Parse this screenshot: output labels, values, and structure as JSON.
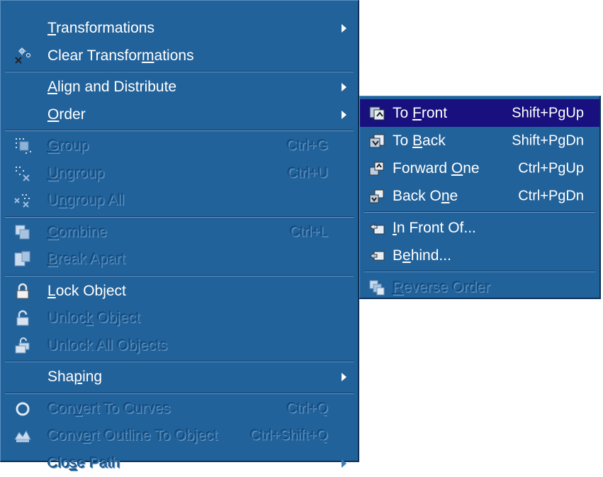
{
  "main_menu": {
    "transformations": {
      "label": "Transformations",
      "accel": "T",
      "icon": "none"
    },
    "clear_transformations": {
      "label": "Clear Transformations",
      "accel": "m",
      "icon": "clear-transform-icon"
    },
    "align_distribute": {
      "label": "Align and Distribute",
      "accel": "A"
    },
    "order": {
      "label": "Order",
      "accel": "O"
    },
    "group": {
      "label": "Group",
      "accel": "G",
      "shortcut": "Ctrl+G",
      "icon": "group-icon"
    },
    "ungroup": {
      "label": "Ungroup",
      "accel": "U",
      "shortcut": "Ctrl+U",
      "icon": "ungroup-icon"
    },
    "ungroup_all": {
      "label": "Ungroup All",
      "accel": "n",
      "icon": "ungroup-all-icon"
    },
    "combine": {
      "label": "Combine",
      "accel": "C",
      "shortcut": "Ctrl+L",
      "icon": "combine-icon"
    },
    "break_apart": {
      "label": "Break Apart",
      "accel": "B",
      "icon": "break-apart-icon"
    },
    "lock_object": {
      "label": "Lock Object",
      "accel": "L",
      "icon": "lock-icon"
    },
    "unlock_object": {
      "label": "Unlock Object",
      "accel": "k",
      "icon": "unlock-icon"
    },
    "unlock_all": {
      "label": "Unlock All Objects",
      "icon": "unlock-all-icon"
    },
    "shaping": {
      "label": "Shaping",
      "accel": "p"
    },
    "convert_curves": {
      "label": "Convert To Curves",
      "accel": "v",
      "shortcut": "Ctrl+Q",
      "icon": "convert-curves-icon"
    },
    "convert_outline": {
      "label": "Convert Outline To Object",
      "accel": "e",
      "shortcut": "Ctrl+Shift+Q",
      "icon": "convert-outline-icon"
    },
    "close_path": {
      "label": "Close Path",
      "accel": "s"
    }
  },
  "order_submenu": {
    "to_front": {
      "label": "To Front",
      "accel": "F",
      "shortcut": "Shift+PgUp",
      "icon": "to-front-icon"
    },
    "to_back": {
      "label": "To Back",
      "accel": "B",
      "shortcut": "Shift+PgDn",
      "icon": "to-back-icon"
    },
    "forward_one": {
      "label": "Forward One",
      "accel": "O",
      "shortcut": "Ctrl+PgUp",
      "icon": "forward-one-icon"
    },
    "back_one": {
      "label": "Back One",
      "accel": "n",
      "shortcut": "Ctrl+PgDn",
      "icon": "back-one-icon"
    },
    "in_front_of": {
      "label": "In Front Of...",
      "accel": "I",
      "icon": "in-front-of-icon"
    },
    "behind": {
      "label": "Behind...",
      "accel": "e",
      "icon": "behind-icon"
    },
    "reverse_order": {
      "label": "Reverse Order",
      "accel": "R",
      "icon": "reverse-order-icon"
    }
  },
  "colors": {
    "menu_bg": "#22629a",
    "highlight": "#17107e",
    "text": "#ffffff"
  }
}
